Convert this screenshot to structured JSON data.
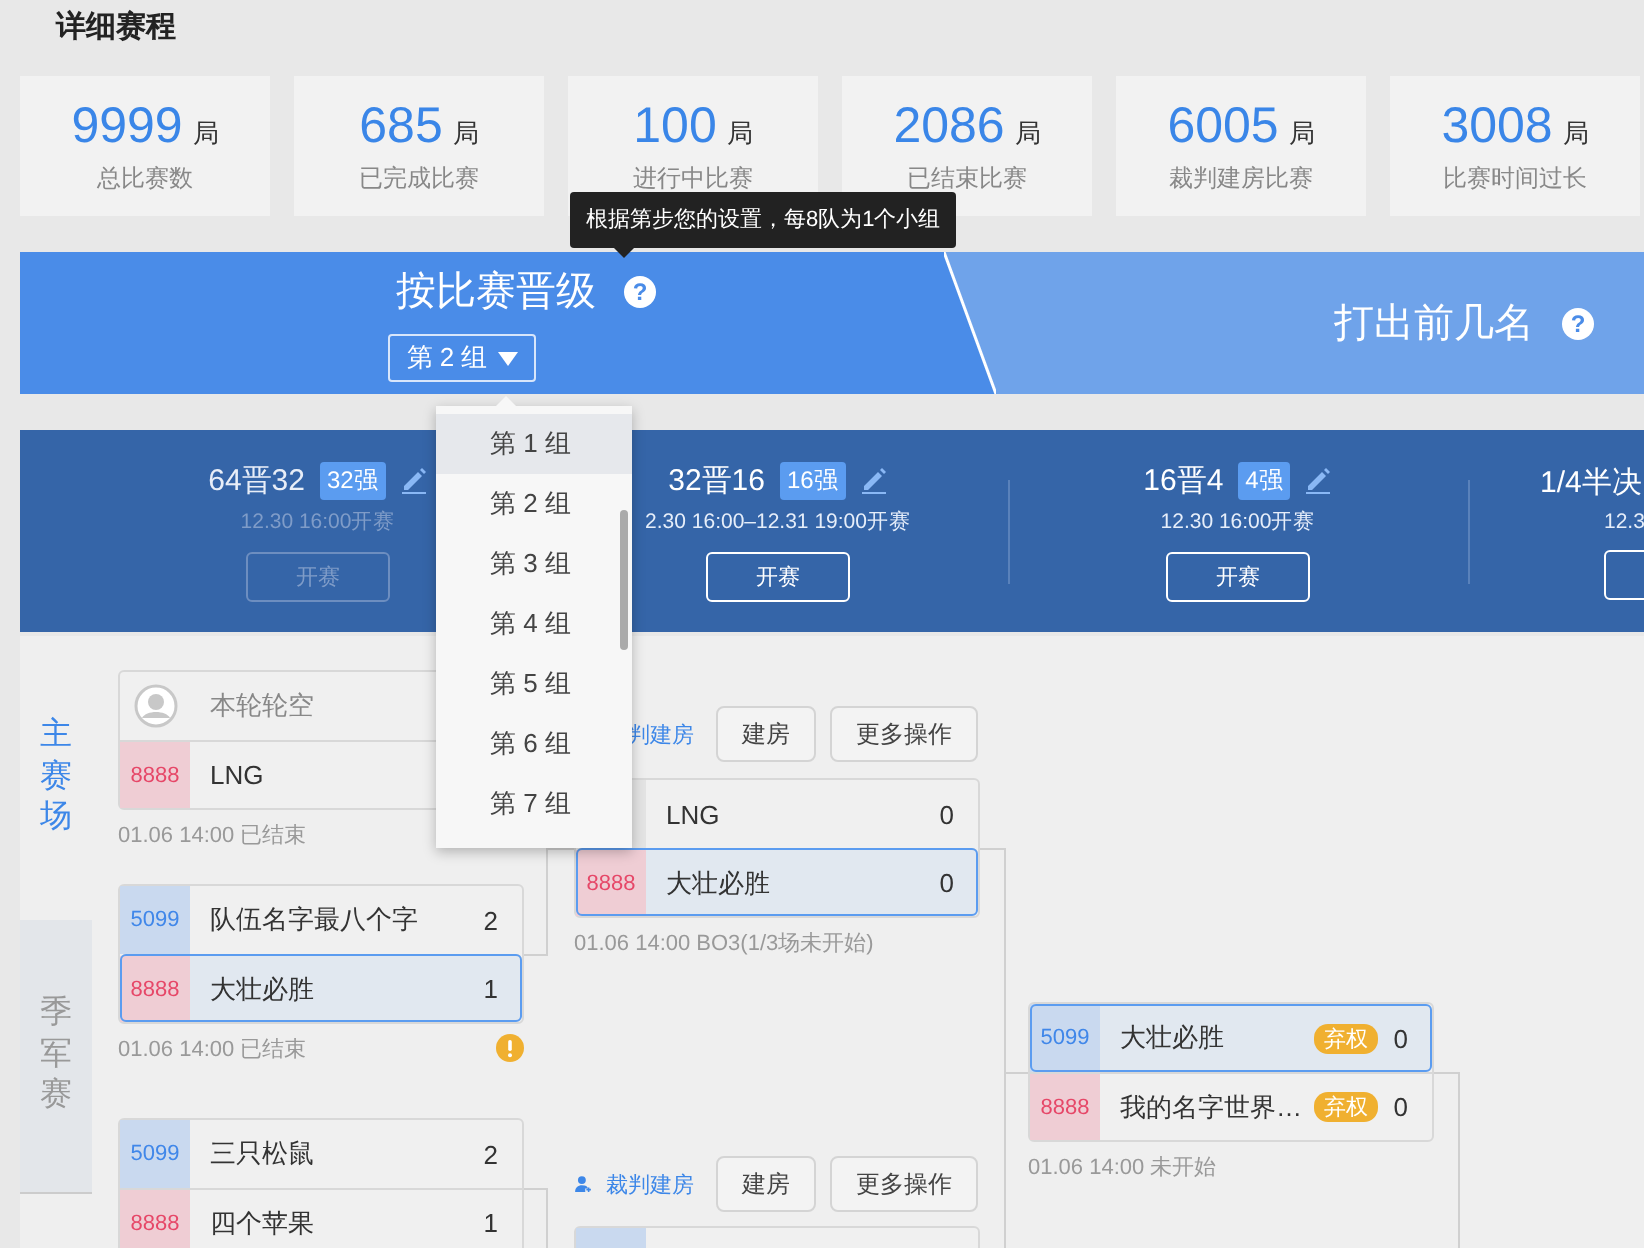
{
  "page_title": "详细赛程",
  "stats": [
    {
      "value": "9999",
      "unit": "局",
      "label": "总比赛数"
    },
    {
      "value": "685",
      "unit": "局",
      "label": "已完成比赛"
    },
    {
      "value": "100",
      "unit": "局",
      "label": "进行中比赛"
    },
    {
      "value": "2086",
      "unit": "局",
      "label": "已结束比赛"
    },
    {
      "value": "6005",
      "unit": "局",
      "label": "裁判建房比赛"
    },
    {
      "value": "3008",
      "unit": "局",
      "label": "比赛时间过长"
    }
  ],
  "tooltip": "根据第步您的设置，每8队为1个小组",
  "modes": [
    {
      "label": "按比赛晋级",
      "help": "?",
      "selected": true,
      "group_value": "第 2 组"
    },
    {
      "label": "打出前几名",
      "help": "?",
      "selected": false
    }
  ],
  "group_dropdown": {
    "expanded": true,
    "options": [
      {
        "label": "第 1 组",
        "highlighted": true
      },
      {
        "label": "第 2 组",
        "highlighted": false
      },
      {
        "label": "第 3 组",
        "highlighted": false
      },
      {
        "label": "第 4 组",
        "highlighted": false
      },
      {
        "label": "第 5 组",
        "highlighted": false
      },
      {
        "label": "第 6 组",
        "highlighted": false
      },
      {
        "label": "第 7 组",
        "highlighted": false
      }
    ]
  },
  "rounds": [
    {
      "title": "64晋32",
      "badge": "32强",
      "time": "12.30 16:00开赛",
      "button": "开赛",
      "disabled": true
    },
    {
      "title": "32晋16",
      "badge": "16强",
      "time": "2.30 16:00–12.31 19:00开赛",
      "button": "开赛",
      "disabled": false
    },
    {
      "title": "16晋4",
      "badge": "4强",
      "time": "12.30 16:00开赛",
      "button": "开赛",
      "disabled": false
    },
    {
      "title": "1/4半决",
      "time": "12.3",
      "disabled": false
    }
  ],
  "side_tabs": [
    {
      "label": "主赛场",
      "selected": true
    },
    {
      "label": "季军赛",
      "selected": false
    }
  ],
  "actions": [
    {
      "referee_icon": false,
      "link": "判建房",
      "buttons": [
        "建房",
        "更多操作"
      ]
    },
    {
      "referee_icon": true,
      "link": "裁判建房",
      "buttons": [
        "建房",
        "更多操作"
      ]
    }
  ],
  "matches": [
    {
      "teams": [
        {
          "kind": "bye",
          "name": "本轮轮空",
          "highlighted": false
        },
        {
          "kind": "team",
          "seed": "8888",
          "color": "#efcdd4",
          "name": "LNG",
          "highlighted": false
        }
      ],
      "footer": "01.06 14:00 已结束",
      "warning": false
    },
    {
      "teams": [
        {
          "kind": "team",
          "seed": "5099",
          "color": "#c9d9ef",
          "name": "队伍名字最八个字",
          "score": "2",
          "highlighted": false
        },
        {
          "kind": "team",
          "seed": "8888",
          "color": "#efcdd4",
          "name": "大壮必胜",
          "score": "1",
          "highlighted": true
        }
      ],
      "footer": "01.06 14:00 已结束",
      "warning": true
    },
    {
      "teams": [
        {
          "kind": "team",
          "seed": "5099",
          "color": "#c9d9ef",
          "name": "三只松鼠",
          "score": "2",
          "highlighted": false
        },
        {
          "kind": "team",
          "seed": "8888",
          "color": "#efcdd4",
          "name": "四个苹果",
          "score": "1",
          "highlighted": false
        }
      ],
      "warning": false
    },
    {
      "teams": [
        {
          "kind": "team",
          "name": "LNG",
          "score": "0",
          "highlighted": false
        },
        {
          "kind": "team",
          "seed": "8888",
          "color": "#efcdd4",
          "name": "大壮必胜",
          "score": "0",
          "highlighted": true
        }
      ],
      "footer": "01.06 14:00 BO3(1/3场未开始)",
      "warning": false
    },
    {
      "teams": [
        {
          "kind": "team",
          "color": "#c9d9ef",
          "highlighted": false
        }
      ],
      "warning": false
    },
    {
      "teams": [
        {
          "kind": "team",
          "seed": "5099",
          "color": "#c9d9ef",
          "name": "大壮必胜",
          "forfeit": "弃权",
          "score": "0",
          "highlighted": true
        },
        {
          "kind": "team",
          "seed": "8888",
          "color": "#efcdd4",
          "name": "我的名字世界…",
          "forfeit": "弃权",
          "score": "0",
          "highlighted": false
        }
      ],
      "footer": "01.06 14:00 未开始",
      "warning": false
    }
  ]
}
